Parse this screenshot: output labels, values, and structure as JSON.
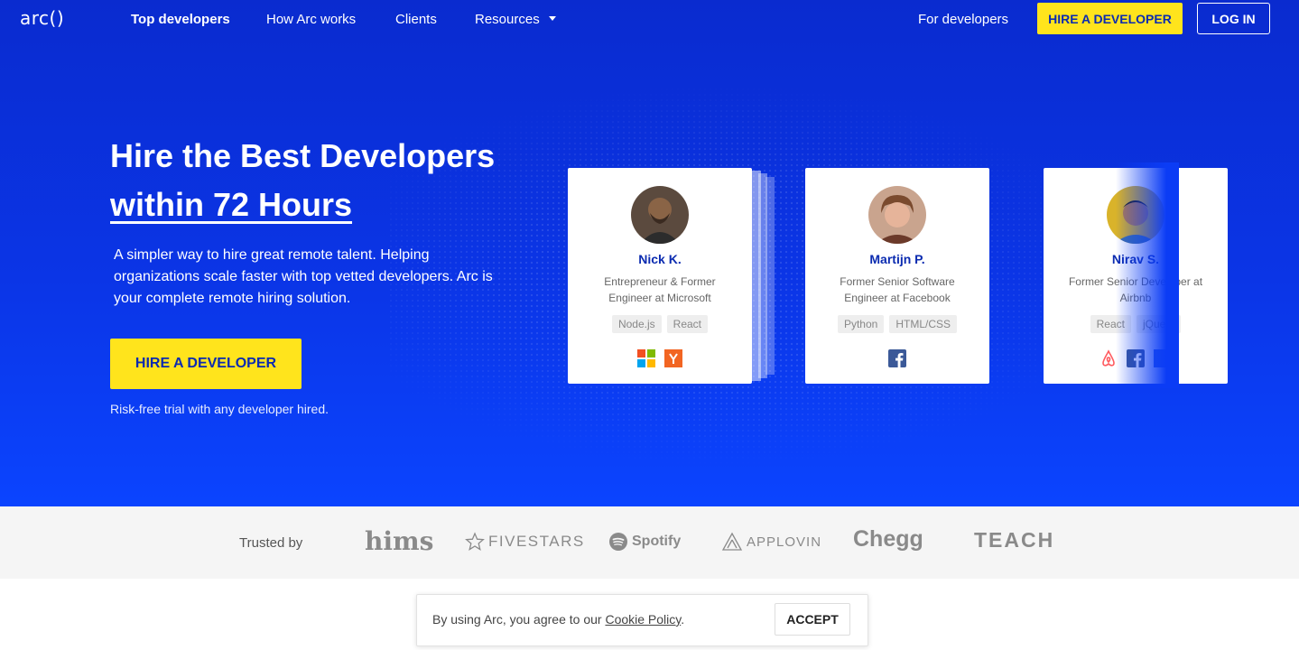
{
  "nav": {
    "logo": "arc()",
    "links": [
      "Top developers",
      "How Arc works",
      "Clients",
      "Resources"
    ],
    "for_developers": "For developers",
    "hire_button": "HIRE A DEVELOPER",
    "login_button": "LOG IN"
  },
  "hero": {
    "title_line1": "Hire the Best Developers",
    "title_line2": "within 72 Hours",
    "lead": "A simpler way to hire great remote talent. Helping organizations scale faster with top vetted developers. Arc is your complete remote hiring solution.",
    "cta": "HIRE A DEVELOPER",
    "risk_free": "Risk-free trial with any developer hired."
  },
  "developers": [
    {
      "name": "Nick K.",
      "title": "Entrepreneur & Former Engineer at Microsoft",
      "tags": [
        "Node.js",
        "React"
      ],
      "logos": [
        "microsoft-icon",
        "ycombinator-icon"
      ]
    },
    {
      "name": "Martijn P.",
      "title": "Former Senior Software Engineer at Facebook",
      "tags": [
        "Python",
        "HTML/CSS"
      ],
      "logos": [
        "facebook-icon"
      ]
    },
    {
      "name": "Nirav S.",
      "title": "Former Senior Developer at Airbnb",
      "tags": [
        "React",
        "jQuery"
      ],
      "logos": [
        "airbnb-icon",
        "facebook-icon",
        "company-icon"
      ]
    }
  ],
  "trusted": {
    "label": "Trusted by",
    "brands": [
      "hims",
      "FIVESTARS",
      "Spotify",
      "APPLOVIN",
      "Chegg",
      "TEACH"
    ]
  },
  "cookie": {
    "text": "By using Arc, you agree to our ",
    "link": "Cookie Policy",
    "suffix": ".",
    "accept": "ACCEPT"
  },
  "colors": {
    "hero_blue": "#0b35e6",
    "accent_yellow": "#ffe41c",
    "name_blue": "#0b2bb0"
  }
}
